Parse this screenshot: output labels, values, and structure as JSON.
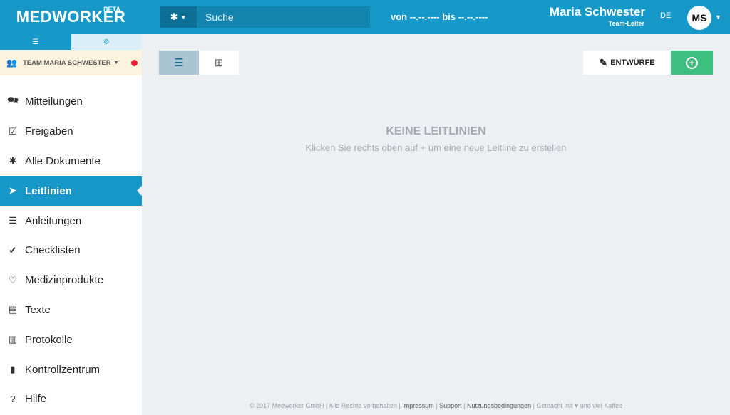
{
  "header": {
    "brand": "MEDWORKER",
    "beta": "BETA",
    "search_filter_icon": "asterisk-icon",
    "search_placeholder": "Suche",
    "date_range": "von --.--.---- bis --.--.----",
    "user_name": "Maria Schwester",
    "user_role": "Team-Leiter",
    "language": "DE",
    "avatar_initials": "MS"
  },
  "sidebar": {
    "menu_toggle_icon": "hamburger-icon",
    "tools_toggle_icon": "gears-icon",
    "team_label": "TEAM MARIA SCHWESTER",
    "items": [
      {
        "label": "Mitteilungen",
        "icon": "chat-bubbles-icon"
      },
      {
        "label": "Freigaben",
        "icon": "checkbox-icon"
      },
      {
        "label": "Alle Dokumente",
        "icon": "asterisk-icon"
      },
      {
        "label": "Leitlinien",
        "icon": "paper-plane-icon",
        "active": true
      },
      {
        "label": "Anleitungen",
        "icon": "list-icon"
      },
      {
        "label": "Checklisten",
        "icon": "check-circle-icon"
      },
      {
        "label": "Medizinprodukte",
        "icon": "heart-pulse-icon"
      },
      {
        "label": "Texte",
        "icon": "book-icon"
      },
      {
        "label": "Protokolle",
        "icon": "clipboard-icon"
      },
      {
        "label": "Kontrollzentrum",
        "icon": "bar-chart-icon"
      },
      {
        "label": "Hilfe",
        "icon": "question-circle-icon"
      }
    ]
  },
  "main": {
    "drafts_label": "ENTWÜRFE",
    "empty_title": "KEINE LEITLINIEN",
    "empty_subtitle": "Klicken Sie rechts oben auf + um eine neue Leitline zu erstellen"
  },
  "footer": {
    "copyright": "© 2017 Medworker GmbH | Alle Rechte vorbehalten | ",
    "impressum": "Impressum",
    "sep1": " | ",
    "support": "Support",
    "sep2": " | ",
    "terms": "Nutzungsbedingungen",
    "tail": " | Gemacht mit ♥ und viel Kaffee"
  },
  "colors": {
    "primary": "#1698c9",
    "add_button": "#3dbf7f",
    "team_bg": "#fcf3de",
    "notification_dot": "#e8192c",
    "background": "#edf0f3"
  }
}
